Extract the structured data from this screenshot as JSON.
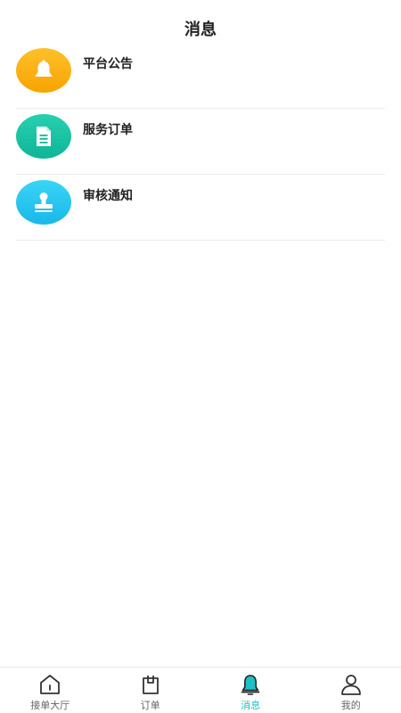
{
  "header": {
    "title": "消息"
  },
  "messages": [
    {
      "label": "平台公告",
      "icon": "bell-icon",
      "color_top": "#ffc02a",
      "color_bottom": "#f7a400"
    },
    {
      "label": "服务订单",
      "icon": "document-icon",
      "color_top": "#27d0b0",
      "color_bottom": "#0fb596"
    },
    {
      "label": "审核通知",
      "icon": "stamp-icon",
      "color_top": "#3ad4f6",
      "color_bottom": "#19b8ea"
    }
  ],
  "tabbar": {
    "tabs": [
      {
        "label": "接单大厅",
        "icon": "home-icon",
        "active": false
      },
      {
        "label": "订单",
        "icon": "clipboard-icon",
        "active": false
      },
      {
        "label": "消息",
        "icon": "bell-icon",
        "active": true
      },
      {
        "label": "我的",
        "icon": "user-icon",
        "active": false
      }
    ],
    "active_color": "#1bc0c8"
  }
}
